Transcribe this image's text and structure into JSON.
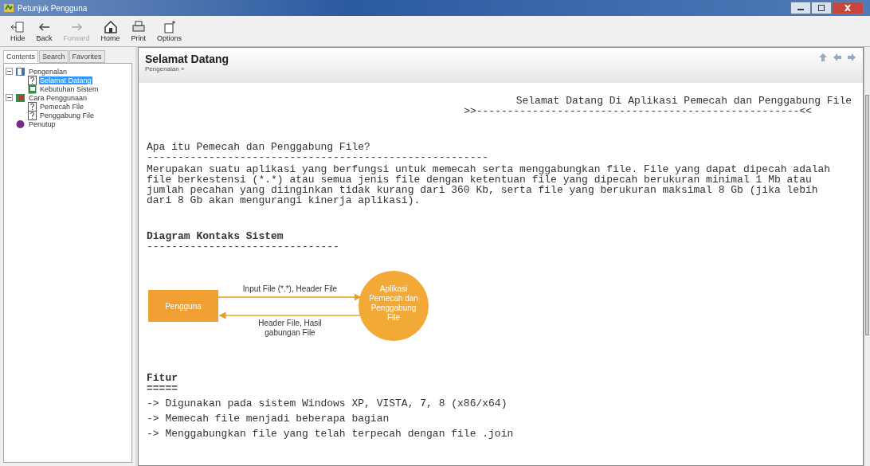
{
  "window": {
    "title": "Petunjuk Pengguna"
  },
  "toolbar": [
    {
      "label": "Hide",
      "kind": "hide",
      "disabled": false
    },
    {
      "label": "Back",
      "kind": "back",
      "disabled": false
    },
    {
      "label": "Forward",
      "kind": "forward",
      "disabled": true
    },
    {
      "label": "Home",
      "kind": "home",
      "disabled": false
    },
    {
      "label": "Print",
      "kind": "print",
      "disabled": false
    },
    {
      "label": "Options",
      "kind": "options",
      "disabled": false
    }
  ],
  "tabs": [
    {
      "label": "Contents",
      "selected": true
    },
    {
      "label": "Search",
      "selected": false
    },
    {
      "label": "Favorites",
      "selected": false
    }
  ],
  "tree": [
    {
      "label": "Pengenalan",
      "kind": "book",
      "expanded": true,
      "selected": false,
      "children": [
        {
          "label": "Selamat Datang",
          "kind": "help",
          "selected": true
        },
        {
          "label": "Kebutuhan Sistem",
          "kind": "page",
          "selected": false
        }
      ]
    },
    {
      "label": "Cara Penggunaan",
      "kind": "book2",
      "expanded": true,
      "selected": false,
      "children": [
        {
          "label": "Pemecah File",
          "kind": "help",
          "selected": false
        },
        {
          "label": "Penggabung File",
          "kind": "help",
          "selected": false
        }
      ]
    },
    {
      "label": "Penutup",
      "kind": "end",
      "selected": false
    }
  ],
  "page": {
    "title": "Selamat Datang",
    "breadcrumb": "Pengenalan »",
    "banner": "Selamat Datang Di Aplikasi Pemecah dan Penggabung File",
    "banner_rule": ">>----------------------------------------------------<<",
    "section1": {
      "heading": "Apa itu Pemecah dan Penggabung File?",
      "rule": "-------------------------------------------------------",
      "body": "Merupakan suatu aplikasi yang berfungsi untuk memecah serta menggabungkan file. File yang dapat dipecah adalah file berkestensi (*.*) atau semua jenis file dengan ketentuan file yang dipecah berukuran minimal 1 Mb atau jumlah pecahan yang diinginkan tidak kurang dari 360 Kb, serta file yang berukuran maksimal 8 Gb (jika lebih dari 8 Gb akan mengurangi kinerja aplikasi)."
    },
    "section2": {
      "heading": "Diagram Kontaks Sistem",
      "rule": "-------------------------------",
      "diagram": {
        "entity": "Pengguna",
        "process": "Aplikasi Pemecah dan Penggabung File",
        "flow_in": "Input File (*.*), Header File",
        "flow_out": "Header File, Hasil gabungan File"
      }
    },
    "section3": {
      "heading": "Fitur",
      "rule": "=====",
      "items": [
        "-> Digunakan pada sistem Windows XP, VISTA, 7, 8 (x86/x64)",
        "-> Memecah file menjadi beberapa bagian",
        "-> Menggabungkan file yang telah terpecah dengan file .join"
      ]
    }
  }
}
